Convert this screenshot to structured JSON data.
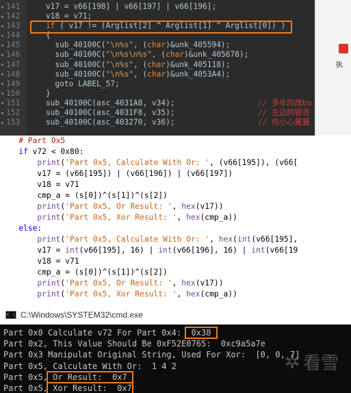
{
  "ida": {
    "lines": [
      {
        "num": "141",
        "segs": [
          [
            "t",
            "    v17 = v66[198] | v66[197] | v66[196];"
          ]
        ]
      },
      {
        "num": "142",
        "segs": [
          [
            "t",
            "    v18 = v71;"
          ]
        ]
      },
      {
        "num": "143",
        "segs": [
          [
            "k",
            "    if"
          ],
          [
            "t",
            " ( v17 != (Arglist[2] ^ Arglist[1] ^ Arglist[0]) )"
          ]
        ]
      },
      {
        "num": "144",
        "segs": [
          [
            "t",
            "    {"
          ]
        ]
      },
      {
        "num": "145",
        "segs": [
          [
            "t",
            "      sub_40100C("
          ],
          [
            "s",
            "\"\\n%s\""
          ],
          [
            "t",
            ", ("
          ],
          [
            "k",
            "char"
          ],
          [
            "t",
            ")&unk_405594);"
          ]
        ]
      },
      {
        "num": "146",
        "segs": [
          [
            "t",
            "      sub_40100C("
          ],
          [
            "s",
            "\"\\n%s\\n%s\""
          ],
          [
            "t",
            ", ("
          ],
          [
            "k",
            "char"
          ],
          [
            "t",
            ")&unk_405678);"
          ]
        ]
      },
      {
        "num": "147",
        "segs": [
          [
            "t",
            "      sub_40100C("
          ],
          [
            "s",
            "\"\\n%s\""
          ],
          [
            "t",
            ", ("
          ],
          [
            "k",
            "char"
          ],
          [
            "t",
            ")&unk_405118);"
          ]
        ]
      },
      {
        "num": "148",
        "segs": [
          [
            "t",
            "      sub_40100C("
          ],
          [
            "s",
            "\"\\n%s\""
          ],
          [
            "t",
            ", ("
          ],
          [
            "k",
            "char"
          ],
          [
            "t",
            ")&unk_4053A4);"
          ]
        ]
      },
      {
        "num": "149",
        "segs": [
          [
            "t",
            "      goto LABEL_57;"
          ]
        ]
      },
      {
        "num": "150",
        "segs": [
          [
            "t",
            "    }"
          ]
        ]
      },
      {
        "num": "151",
        "segs": [
          [
            "t",
            "    sub_40100C(asc_4031A8, v34);                  "
          ],
          [
            "c",
            "// 多年的改bu"
          ]
        ]
      },
      {
        "num": "152",
        "segs": [
          [
            "t",
            "    sub_40100C(asc_4031F8, v35);                  "
          ],
          [
            "c",
            "// 左边的银杏"
          ]
        ]
      },
      {
        "num": "153",
        "segs": [
          [
            "t",
            "    sub_40100C(asc_403270, v36);                  "
          ],
          [
            "c",
            "// 你小心翼翼"
          ]
        ]
      }
    ],
    "ribbon_glyph": "执"
  },
  "python": {
    "lines": [
      [
        [
          "c",
          "    # Part 0x5"
        ]
      ],
      [
        [
          "k",
          "    if"
        ],
        [
          "t",
          " v72 < 0x80:"
        ]
      ],
      [
        [
          "f",
          "        print"
        ],
        [
          "t",
          "("
        ],
        [
          "s",
          "'Part 0x5, Calculate With Or: '"
        ],
        [
          "t",
          ", (v66[195]), (v66["
        ]
      ],
      [
        [
          "t",
          "        v17 = (v66[195]) | (v66[196]) | (v66[197])"
        ]
      ],
      [
        [
          "t",
          "        v18 = v71"
        ]
      ],
      [
        [
          "t",
          "        cmp_a = (s[0])^(s[1])^(s[2])"
        ]
      ],
      [
        [
          "f",
          "        print"
        ],
        [
          "t",
          "("
        ],
        [
          "s",
          "'Part 0x5, Or Result: '"
        ],
        [
          "t",
          ", "
        ],
        [
          "f",
          "hex"
        ],
        [
          "t",
          "(v17))"
        ]
      ],
      [
        [
          "f",
          "        print"
        ],
        [
          "t",
          "("
        ],
        [
          "s",
          "'Part 0x5, Xor Result: '"
        ],
        [
          "t",
          ", "
        ],
        [
          "f",
          "hex"
        ],
        [
          "t",
          "(cmp_a))"
        ]
      ],
      [
        [
          "k",
          "    else"
        ],
        [
          "t",
          ":"
        ]
      ],
      [
        [
          "f",
          "        print"
        ],
        [
          "t",
          "("
        ],
        [
          "s",
          "'Part 0x5, Calculate With Or: '"
        ],
        [
          "t",
          ", "
        ],
        [
          "f",
          "hex"
        ],
        [
          "t",
          "("
        ],
        [
          "f",
          "int"
        ],
        [
          "t",
          "(v66[195],"
        ]
      ],
      [
        [
          "t",
          "        v17 = "
        ],
        [
          "f",
          "int"
        ],
        [
          "t",
          "(v66[195], 16) | "
        ],
        [
          "f",
          "int"
        ],
        [
          "t",
          "(v66[196], 16) | "
        ],
        [
          "f",
          "int"
        ],
        [
          "t",
          "(v66[19"
        ]
      ],
      [
        [
          "t",
          "        v18 = v71"
        ]
      ],
      [
        [
          "t",
          "        cmp_a = (s[0])^(s[1])^(s[2])"
        ]
      ],
      [
        [
          "f",
          "        print"
        ],
        [
          "t",
          "("
        ],
        [
          "s",
          "'Part 0x5, Or Result: '"
        ],
        [
          "t",
          ", "
        ],
        [
          "f",
          "hex"
        ],
        [
          "t",
          "(v17))"
        ]
      ],
      [
        [
          "f",
          "        print"
        ],
        [
          "t",
          "("
        ],
        [
          "s",
          "'Part 0x5, Xor Result: '"
        ],
        [
          "t",
          ", "
        ],
        [
          "f",
          "hex"
        ],
        [
          "t",
          "(cmp_a))"
        ]
      ]
    ]
  },
  "cmd": {
    "title": "C:\\Windows\\SYSTEM32\\cmd.exe",
    "lines": [
      [
        [
          "t",
          "Part 0x0 Calculate v72 For Part 0x4: "
        ],
        [
          "b",
          " 0x38 "
        ]
      ],
      [
        [
          "t",
          "Part 0x2, This Value Should Be 0xF52E0765:  0xc9a5a7e"
        ]
      ],
      [
        [
          "t",
          "Part 0x3 Manipulat Original String, Used For Xor:  [0, 0, 7]"
        ]
      ],
      [
        [
          "t",
          "Part 0x5, Calculate With Or:  1 4 2"
        ]
      ],
      [
        [
          "t",
          "Part 0x5,"
        ],
        [
          "b",
          " Or Result:  0x7 "
        ]
      ],
      [
        [
          "t",
          "Part 0x5,"
        ],
        [
          "b",
          " Xor Result:  0x7"
        ]
      ]
    ]
  },
  "watermark": {
    "text": "看雪",
    "icon": "snowflake-icon"
  }
}
